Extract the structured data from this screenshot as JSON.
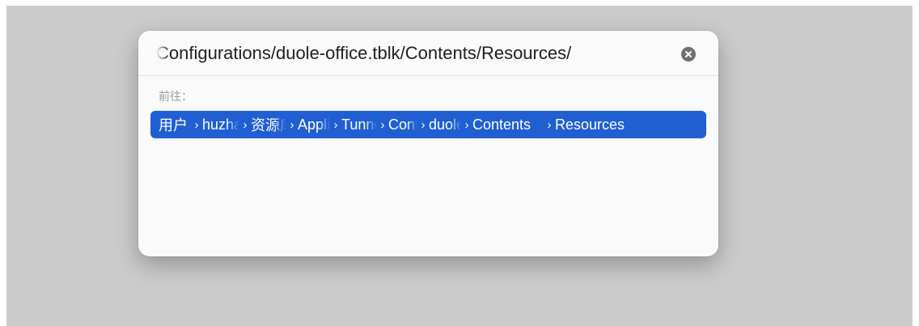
{
  "go_to_folder": {
    "path_value": "Configurations/duole-office.tblk/Contents/Resources/",
    "clear_icon": "x-circle-icon",
    "goto_label": "前往：",
    "breadcrumbs": [
      "用户",
      "huzhang",
      "资源库",
      "Application Support",
      "Tunnelblick",
      "Configurations",
      "duole-office.tblk",
      "Contents",
      "Resources"
    ],
    "separator": "›",
    "highlight_color": "#1f5fd2"
  }
}
